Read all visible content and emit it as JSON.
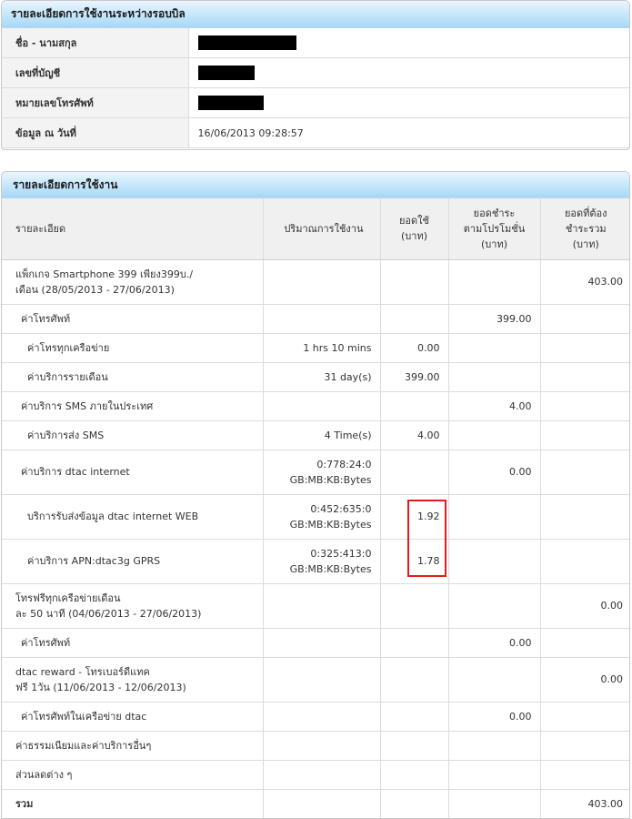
{
  "info": {
    "title": "รายละเอียดการใช้งานระหว่างรอบบิล",
    "rows": [
      {
        "label": "ชื่อ - นามสกุล",
        "value": ""
      },
      {
        "label": "เลขที่บัญชี",
        "value": ""
      },
      {
        "label": "หมายเลขโทรศัพท์",
        "value": ""
      },
      {
        "label": "ข้อมูล ณ วันที่",
        "value": "16/06/2013 09:28:57"
      }
    ]
  },
  "usage": {
    "title": "รายละเอียดการใช้งาน",
    "headers": {
      "detail": "รายละเอียด",
      "quantity": "ปริมาณการใช้งาน",
      "used": "ยอดใช้\n(บาท)",
      "promo": "ยอดชำระ\nตามโปรโมชั่น\n(บาท)",
      "total": "ยอดที่ต้อง\nชำระรวม\n(บาท)"
    },
    "rows": [
      {
        "detail": "แพ็กเกจ Smartphone 399 เพียง399บ./\nเดือน (28/05/2013 - 27/06/2013)",
        "qty": "",
        "used": "",
        "promo": "",
        "total": "403.00",
        "indent": 0,
        "h": 49
      },
      {
        "detail": "ค่าโทรศัพท์",
        "qty": "",
        "used": "",
        "promo": "399.00",
        "total": "",
        "indent": 1,
        "h": 32
      },
      {
        "detail": "ค่าโทรทุกเครือข่าย",
        "qty": "1 hrs 10 mins",
        "used": "0.00",
        "promo": "",
        "total": "",
        "indent": 2,
        "h": 32
      },
      {
        "detail": "ค่าบริการรายเดือน",
        "qty": "31 day(s)",
        "used": "399.00",
        "promo": "",
        "total": "",
        "indent": 2,
        "h": 32
      },
      {
        "detail": "ค่าบริการ SMS ภายในประเทศ",
        "qty": "",
        "used": "",
        "promo": "4.00",
        "total": "",
        "indent": 1,
        "h": 32
      },
      {
        "detail": "ค่าบริการส่ง SMS",
        "qty": "4 Time(s)",
        "used": "4.00",
        "promo": "",
        "total": "",
        "indent": 2,
        "h": 32
      },
      {
        "detail": "ค่าบริการ dtac internet",
        "qty": "0:778:24:0\nGB:MB:KB:Bytes",
        "used": "",
        "promo": "0.00",
        "total": "",
        "indent": 1,
        "h": 49
      },
      {
        "detail": "บริการรับส่งข้อมูล dtac internet WEB",
        "qty": "0:452:635:0\nGB:MB:KB:Bytes",
        "used": "1.92",
        "promo": "",
        "total": "",
        "indent": 2,
        "h": 49
      },
      {
        "detail": "ค่าบริการ APN:dtac3g GPRS",
        "qty": "0:325:413:0\nGB:MB:KB:Bytes",
        "used": "1.78",
        "promo": "",
        "total": "",
        "indent": 2,
        "h": 49
      },
      {
        "detail": "โทรฟรีทุกเครือข่ายเดือน\nละ 50 นาที (04/06/2013 - 27/06/2013)",
        "qty": "",
        "used": "",
        "promo": "",
        "total": "0.00",
        "indent": 0,
        "h": 49
      },
      {
        "detail": "ค่าโทรศัพท์",
        "qty": "",
        "used": "",
        "promo": "0.00",
        "total": "",
        "indent": 1,
        "h": 32
      },
      {
        "detail": "dtac reward - โทรเบอร์ดีแทค\nฟรี 1วัน (11/06/2013 - 12/06/2013)",
        "qty": "",
        "used": "",
        "promo": "",
        "total": "0.00",
        "indent": 0,
        "h": 49
      },
      {
        "detail": "ค่าโทรศัพท์ในเครือข่าย dtac",
        "qty": "",
        "used": "",
        "promo": "0.00",
        "total": "",
        "indent": 1,
        "h": 32
      },
      {
        "detail": "ค่าธรรมเนียมและค่าบริการอื่นๆ",
        "qty": "",
        "used": "",
        "promo": "",
        "total": "",
        "indent": 0,
        "h": 32
      },
      {
        "detail": "ส่วนลดต่าง ๆ",
        "qty": "",
        "used": "",
        "promo": "",
        "total": "",
        "indent": 0,
        "h": 32
      }
    ],
    "total": {
      "label": "รวม",
      "value": "403.00"
    }
  }
}
